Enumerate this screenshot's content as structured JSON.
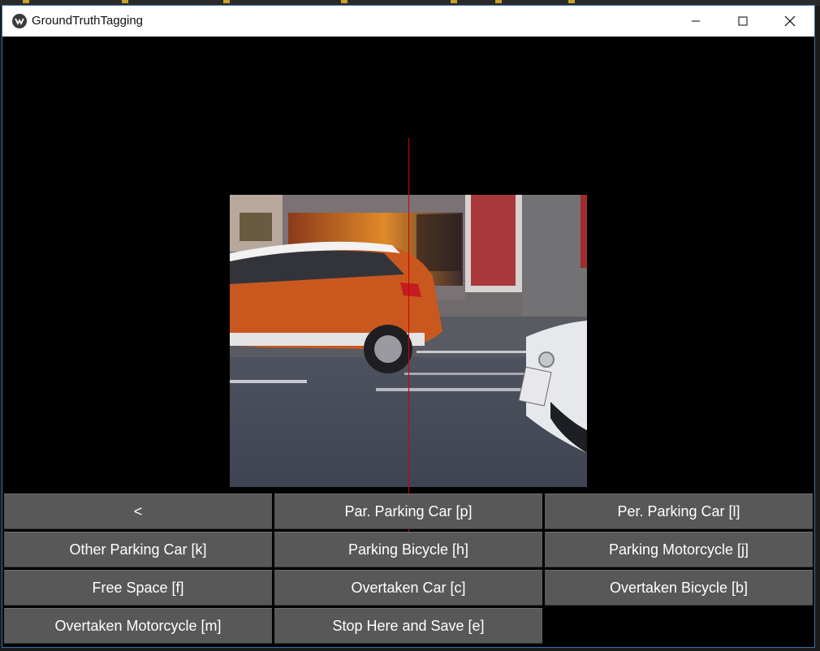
{
  "window": {
    "title": "GroundTruthTagging"
  },
  "buttons": [
    {
      "label": "<"
    },
    {
      "label": "Par. Parking Car [p]"
    },
    {
      "label": "Per. Parking Car [l]"
    },
    {
      "label": "Other Parking Car [k]"
    },
    {
      "label": "Parking Bicycle [h]"
    },
    {
      "label": "Parking Motorcycle [j]"
    },
    {
      "label": "Free Space [f]"
    },
    {
      "label": "Overtaken Car [c]"
    },
    {
      "label": "Overtaken Bicycle [b]"
    },
    {
      "label": "Overtaken Motorcycle [m]"
    },
    {
      "label": "Stop Here and Save [e]"
    }
  ],
  "colors": {
    "marker_line": "#d40000",
    "button_bg": "#585858",
    "canvas_bg": "#000000"
  }
}
